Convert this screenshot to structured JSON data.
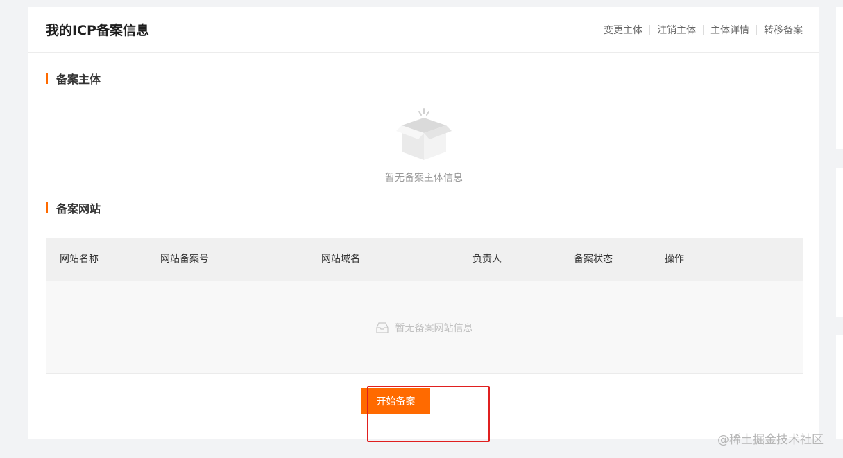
{
  "header": {
    "title": "我的ICP备案信息",
    "links": [
      "变更主体",
      "注销主体",
      "主体详情",
      "转移备案"
    ]
  },
  "entity_section": {
    "title": "备案主体",
    "empty_text": "暂无备案主体信息",
    "empty_icon": "open-box-icon"
  },
  "website_section": {
    "title": "备案网站",
    "columns": [
      "网站名称",
      "网站备案号",
      "网站域名",
      "负责人",
      "备案状态",
      "操作"
    ],
    "empty_text": "暂无备案网站信息",
    "empty_icon": "tray-icon"
  },
  "actions": {
    "start_label": "开始备案"
  },
  "watermark": "@稀土掘金技术社区",
  "colors": {
    "accent": "#ff6a00",
    "highlight": "#e02020"
  }
}
